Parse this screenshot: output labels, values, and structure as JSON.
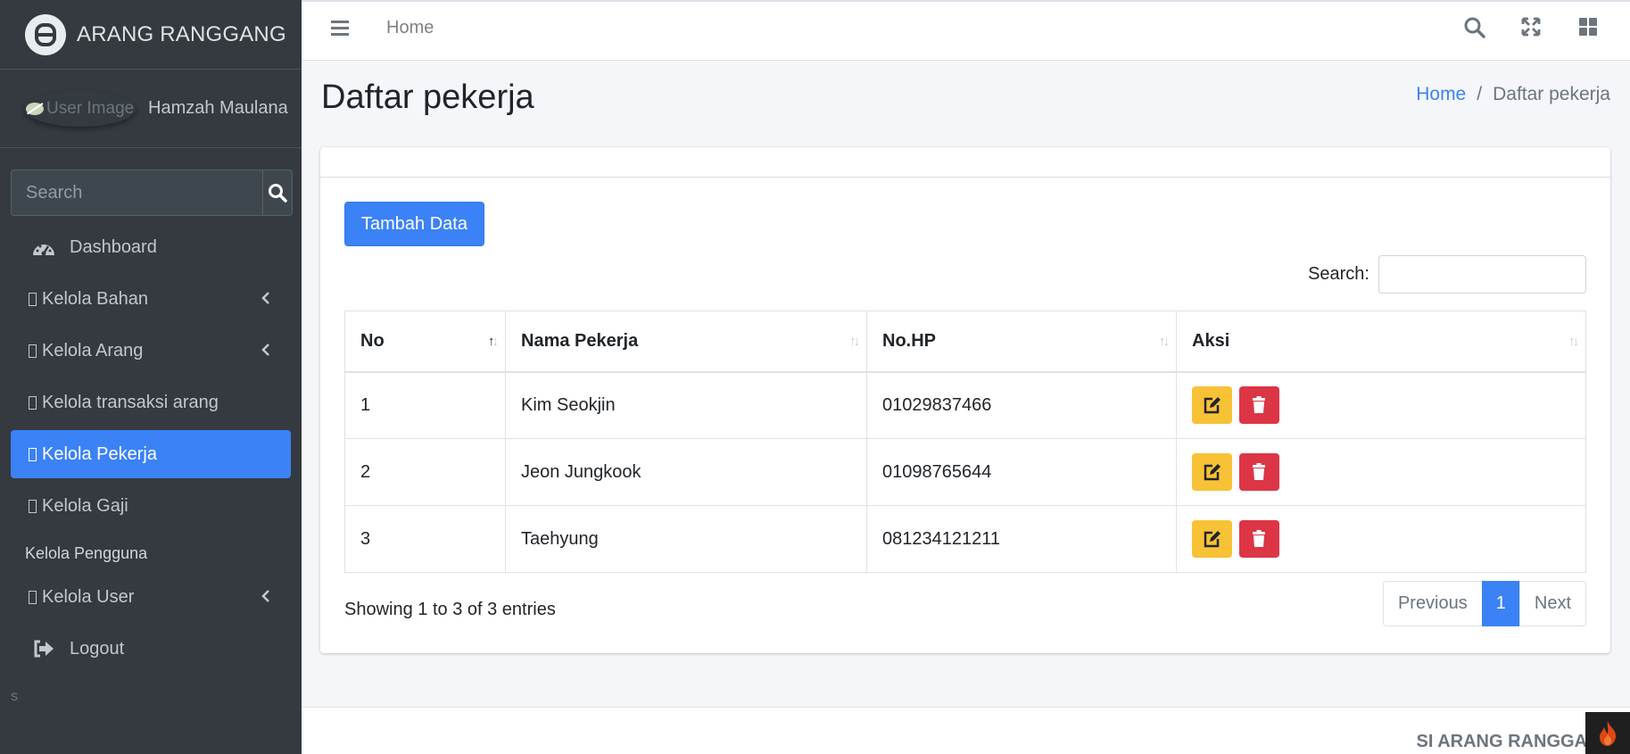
{
  "brand": {
    "name": "ARANG RANGGANG"
  },
  "user": {
    "image_alt": "User Image",
    "name": "Hamzah Maulana"
  },
  "sidebar_search": {
    "placeholder": "Search"
  },
  "nav": {
    "dashboard": "Dashboard",
    "kelola_bahan": "Kelola Bahan",
    "kelola_arang": "Kelola Arang",
    "kelola_transaksi": "Kelola transaksi arang",
    "kelola_pekerja": "Kelola Pekerja",
    "kelola_gaji": "Kelola Gaji",
    "header_pengguna": "Kelola Pengguna",
    "kelola_user": "Kelola User",
    "logout": "Logout",
    "stray": "s"
  },
  "topbar": {
    "home": "Home"
  },
  "page": {
    "title": "Daftar pekerja"
  },
  "breadcrumb": {
    "home": "Home",
    "separator": "/",
    "current": "Daftar pekerja"
  },
  "card": {
    "add_button": "Tambah Data",
    "search_label": "Search:",
    "columns": [
      "No",
      "Nama Pekerja",
      "No.HP",
      "Aksi"
    ],
    "rows": [
      {
        "no": "1",
        "nama": "Kim Seokjin",
        "hp": "01029837466"
      },
      {
        "no": "2",
        "nama": "Jeon Jungkook",
        "hp": "01098765644"
      },
      {
        "no": "3",
        "nama": "Taehyung",
        "hp": "081234121211"
      }
    ],
    "info": "Showing 1 to 3 of 3 entries",
    "pagination": {
      "previous": "Previous",
      "page": "1",
      "next": "Next"
    }
  },
  "footer": {
    "text": "SI ARANG RANGGA"
  },
  "colors": {
    "primary": "#3b82f6",
    "sidebar": "#343a40",
    "edit": "#f7c235",
    "delete": "#dc3545"
  },
  "icons": [
    "brand-logo-icon",
    "search-icon",
    "dashboard-gauge-icon",
    "chevron-left-icon",
    "logout-icon",
    "menu-bars-icon",
    "expand-icon",
    "grid-icon",
    "edit-icon",
    "trash-icon",
    "fire-icon"
  ]
}
